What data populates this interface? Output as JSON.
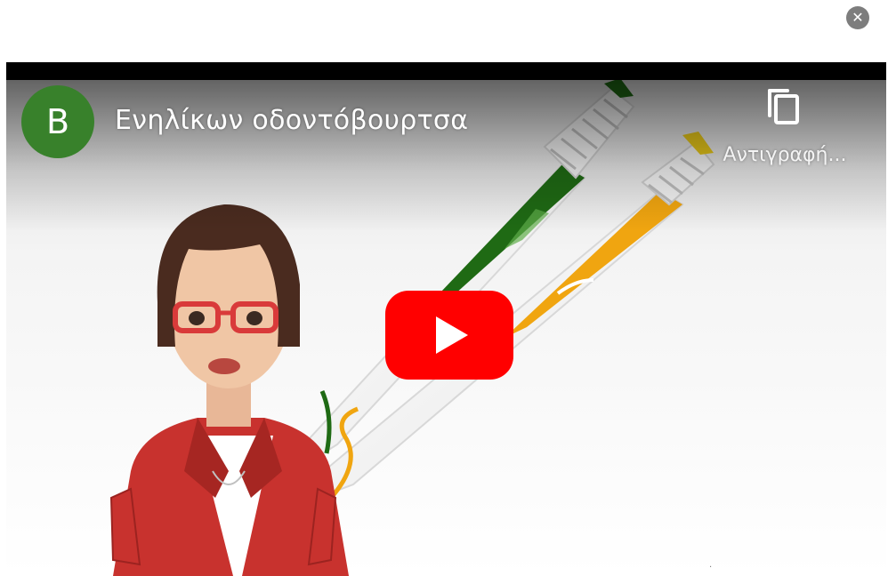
{
  "dialog": {
    "close_icon_glyph": "✕"
  },
  "video": {
    "channel_initial": "B",
    "title": "Ενηλίκων οδοντόβουρτσα",
    "copy_label": "Αντιγραφή...",
    "icons": {
      "close": "close-icon",
      "copy": "copy-link-icon",
      "play": "youtube-play-icon"
    },
    "colors": {
      "avatar": "#38812b",
      "play_button": "#ff0000",
      "toothbrush_green": "#1f6a14",
      "toothbrush_orange": "#f0a510",
      "jacket": "#c8322e"
    }
  }
}
